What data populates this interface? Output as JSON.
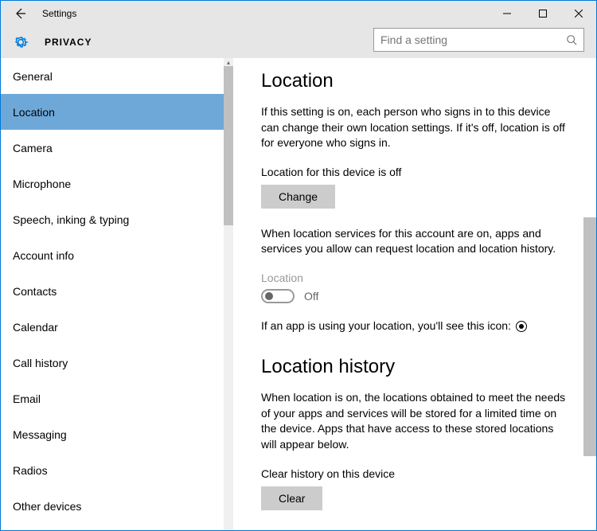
{
  "titlebar": {
    "title": "Settings"
  },
  "header": {
    "title": "PRIVACY"
  },
  "search": {
    "placeholder": "Find a setting"
  },
  "sidebar": {
    "items": [
      {
        "label": "General"
      },
      {
        "label": "Location"
      },
      {
        "label": "Camera"
      },
      {
        "label": "Microphone"
      },
      {
        "label": "Speech, inking & typing"
      },
      {
        "label": "Account info"
      },
      {
        "label": "Contacts"
      },
      {
        "label": "Calendar"
      },
      {
        "label": "Call history"
      },
      {
        "label": "Email"
      },
      {
        "label": "Messaging"
      },
      {
        "label": "Radios"
      },
      {
        "label": "Other devices"
      }
    ],
    "selected_index": 1
  },
  "main": {
    "location": {
      "heading": "Location",
      "desc": "If this setting is on, each person who signs in to this device can change their own location settings. If it's off, location is off for everyone who signs in.",
      "device_status": "Location for this device is off",
      "change_btn": "Change",
      "services_desc": "When location services for this account are on, apps and services you allow can request location and location history.",
      "toggle_label": "Location",
      "toggle_state": "Off",
      "icon_text": "If an app is using your location, you'll see this icon:"
    },
    "history": {
      "heading": "Location history",
      "desc": "When location is on, the locations obtained to meet the needs of your apps and services will be stored for a limited time on the device. Apps that have access to these stored locations will appear below.",
      "clear_label": "Clear history on this device",
      "clear_btn": "Clear"
    }
  }
}
